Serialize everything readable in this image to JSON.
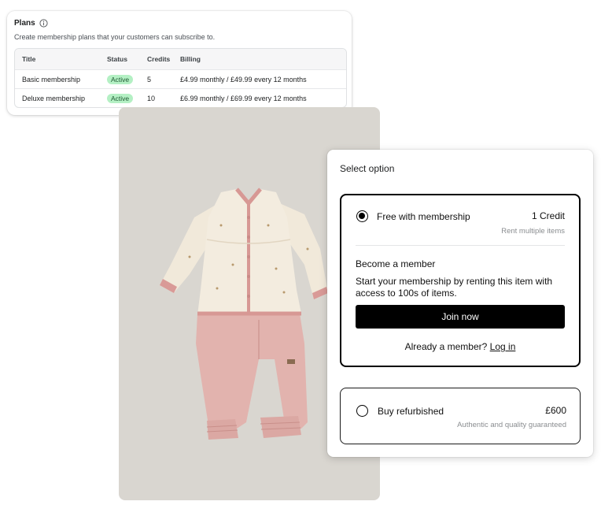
{
  "plans": {
    "title": "Plans",
    "subtitle": "Create membership plans that your customers can subscribe to.",
    "columns": [
      "Title",
      "Status",
      "Credits",
      "Billing"
    ],
    "rows": [
      {
        "title": "Basic membership",
        "status": "Active",
        "credits": "5",
        "billing": "£4.99 monthly / £49.99 every 12 months"
      },
      {
        "title": "Deluxe membership",
        "status": "Active",
        "credits": "10",
        "billing": "£6.99 monthly / £69.99 every 12 months"
      }
    ]
  },
  "product": {
    "image_subject": "baby cardigan and trousers outfit"
  },
  "options": {
    "title": "Select option",
    "membership": {
      "name": "Free with membership",
      "price": "1 Credit",
      "note": "Rent multiple items",
      "selected": true,
      "become_heading": "Become a member",
      "become_desc": "Start your membership by renting this item with access to 100s of items.",
      "join_label": "Join now",
      "already_text": "Already a member?",
      "login_label": "Log in"
    },
    "refurbished": {
      "name": "Buy refurbished",
      "price": "£600",
      "note": "Authentic and quality guaranteed",
      "selected": false
    }
  },
  "colors": {
    "active_badge_bg": "#b4f0c4",
    "active_badge_text": "#1f5a33",
    "photo_bg": "#d9d6d0",
    "button_bg": "#000000"
  }
}
